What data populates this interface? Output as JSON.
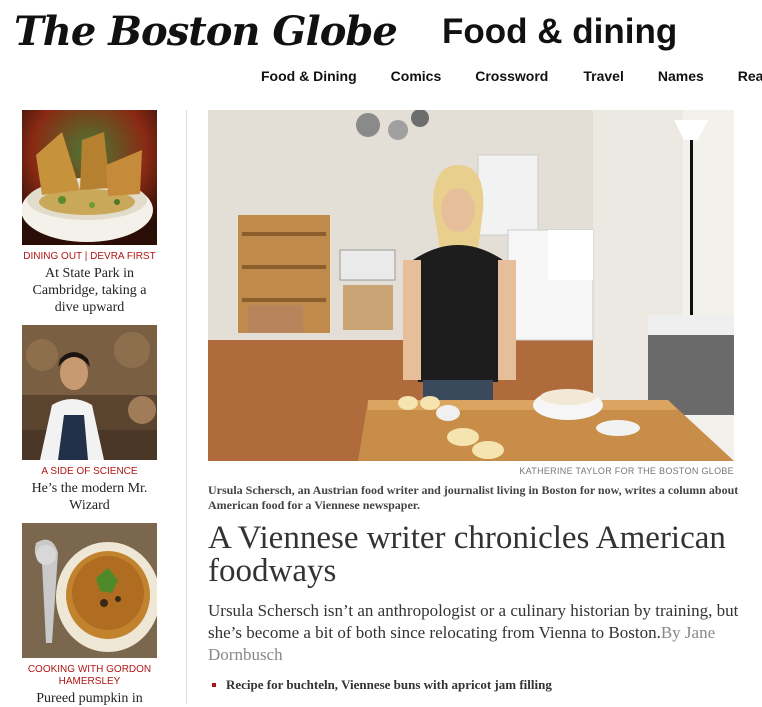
{
  "header": {
    "masthead": "The Boston Globe",
    "section_title": "Food & dining"
  },
  "nav": {
    "items": [
      "Food & Dining",
      "Comics",
      "Crossword",
      "Travel",
      "Names",
      "Real"
    ]
  },
  "sidebar": {
    "items": [
      {
        "kicker": "DINING OUT | DEVRA FIRST",
        "headline": "At State Park in Cambridge, taking a dive upward"
      },
      {
        "kicker": "A SIDE OF SCIENCE",
        "headline": "He’s the modern Mr. Wizard"
      },
      {
        "kicker": "COOKING WITH GORDON HAMERSLEY",
        "headline": "Pureed pumpkin in"
      }
    ]
  },
  "lead": {
    "photo_credit": "KATHERINE TAYLOR FOR THE BOSTON GLOBE",
    "caption": "Ursula Schersch, an Austrian food writer and journalist living in Boston for now, writes a column about American food for a Viennese newspaper.",
    "headline": "A Viennese writer chronicles American foodways",
    "dek": "Ursula Schersch isn’t an anthropologist or a culinary historian by training, but she’s become a bit of both since relocating from Vienna to Boston.",
    "byline": "By Jane Dornbusch",
    "related": "Recipe for buchteln, Viennese buns with apricot jam filling"
  },
  "colors": {
    "kicker": "#b01515",
    "byline": "#888888"
  }
}
